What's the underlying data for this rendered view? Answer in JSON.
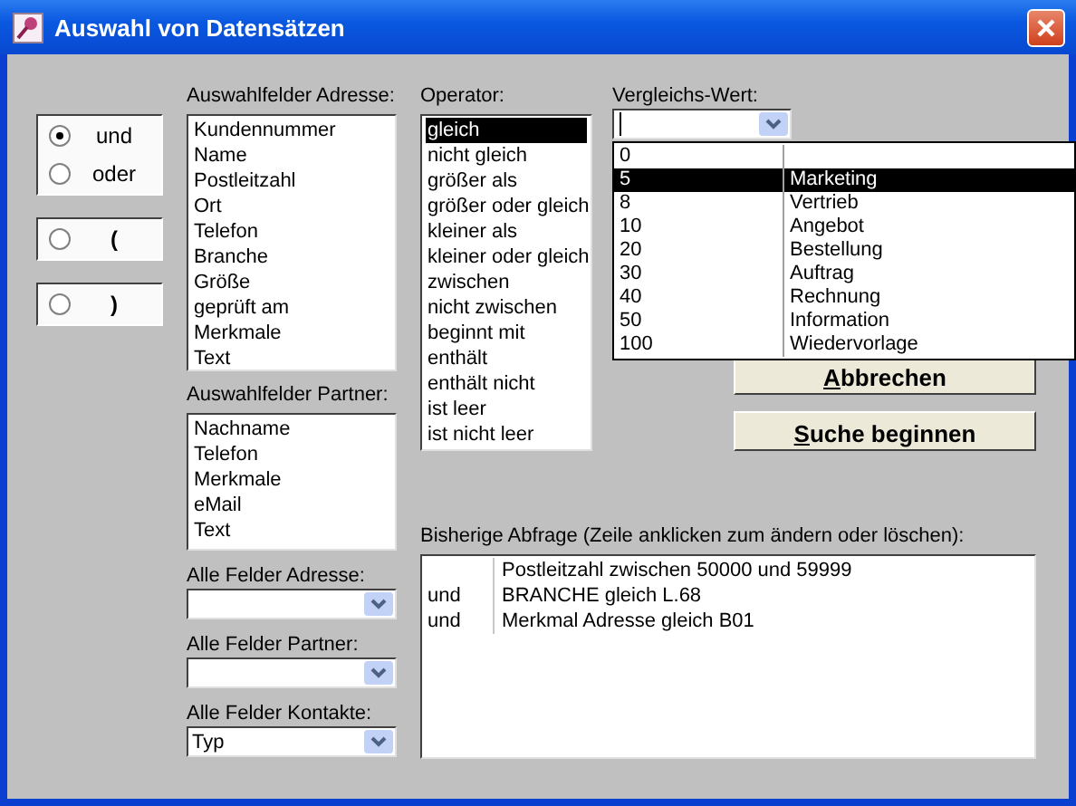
{
  "window": {
    "title": "Auswahl von Datensätzen"
  },
  "connectors": [
    {
      "options": [
        {
          "label": "und",
          "selected": true
        },
        {
          "label": "oder",
          "selected": false
        }
      ]
    },
    {
      "options": [
        {
          "label": "(",
          "selected": false
        }
      ]
    },
    {
      "options": [
        {
          "label": ")",
          "selected": false
        }
      ]
    }
  ],
  "address_fields": {
    "label": "Auswahlfelder Adresse:",
    "items": [
      "Kundennummer",
      "Name",
      "Postleitzahl",
      "Ort",
      "Telefon",
      "Branche",
      "Größe",
      "geprüft am",
      "Merkmale",
      "Text"
    ]
  },
  "partner_fields": {
    "label": "Auswahlfelder Partner:",
    "items": [
      "Nachname",
      "Telefon",
      "Merkmale",
      "eMail",
      "Text"
    ]
  },
  "all_fields": [
    {
      "label": "Alle Felder Adresse:"
    },
    {
      "label": "Alle Felder Partner:"
    },
    {
      "label": "Alle Felder Kontakte:",
      "value": "Typ"
    }
  ],
  "operator": {
    "label": "Operator:",
    "items": [
      {
        "text": "gleich",
        "selected": true
      },
      {
        "text": "nicht gleich",
        "selected": false
      },
      {
        "text": "größer als",
        "selected": false
      },
      {
        "text": "größer oder gleich",
        "selected": false
      },
      {
        "text": "kleiner als",
        "selected": false
      },
      {
        "text": "kleiner oder gleich",
        "selected": false
      },
      {
        "text": "zwischen",
        "selected": false
      },
      {
        "text": "nicht zwischen",
        "selected": false
      },
      {
        "text": "beginnt mit",
        "selected": false
      },
      {
        "text": "enthält",
        "selected": false
      },
      {
        "text": "enthält nicht",
        "selected": false
      },
      {
        "text": "ist leer",
        "selected": false
      },
      {
        "text": "ist nicht leer",
        "selected": false
      }
    ]
  },
  "comparison": {
    "label": "Vergleichs-Wert:",
    "dropdown": {
      "rows": [
        {
          "code": "0",
          "selected": false
        },
        {
          "code": "5",
          "name": "Marketing",
          "selected": true
        },
        {
          "code": "8",
          "name": "Vertrieb",
          "selected": false
        },
        {
          "code": "10",
          "name": "Angebot",
          "selected": false
        },
        {
          "code": "20",
          "name": "Bestellung",
          "selected": false
        },
        {
          "code": "30",
          "name": "Auftrag",
          "selected": false
        },
        {
          "code": "40",
          "name": "Rechnung",
          "selected": false
        },
        {
          "code": "50",
          "name": "Information",
          "selected": false
        },
        {
          "code": "100",
          "name": "Wiedervorlage",
          "selected": false
        }
      ]
    }
  },
  "buttons": [
    {
      "label_parts": [
        {
          "text": "A",
          "underlined": true
        },
        {
          "text": "bbrechen",
          "underlined": false
        }
      ]
    },
    {
      "label_parts": [
        {
          "text": "S",
          "underlined": true
        },
        {
          "text": "uche beginnen",
          "underlined": false
        }
      ]
    }
  ],
  "query": {
    "label": "Bisherige Abfrage (Zeile anklicken zum ändern oder löschen):",
    "rows": [
      {
        "condition": "Postleitzahl zwischen 50000 und 59999"
      },
      {
        "connector": "und",
        "condition": "BRANCHE gleich L.68"
      },
      {
        "connector": "und",
        "condition": "Merkmal Adresse gleich B01"
      }
    ]
  }
}
